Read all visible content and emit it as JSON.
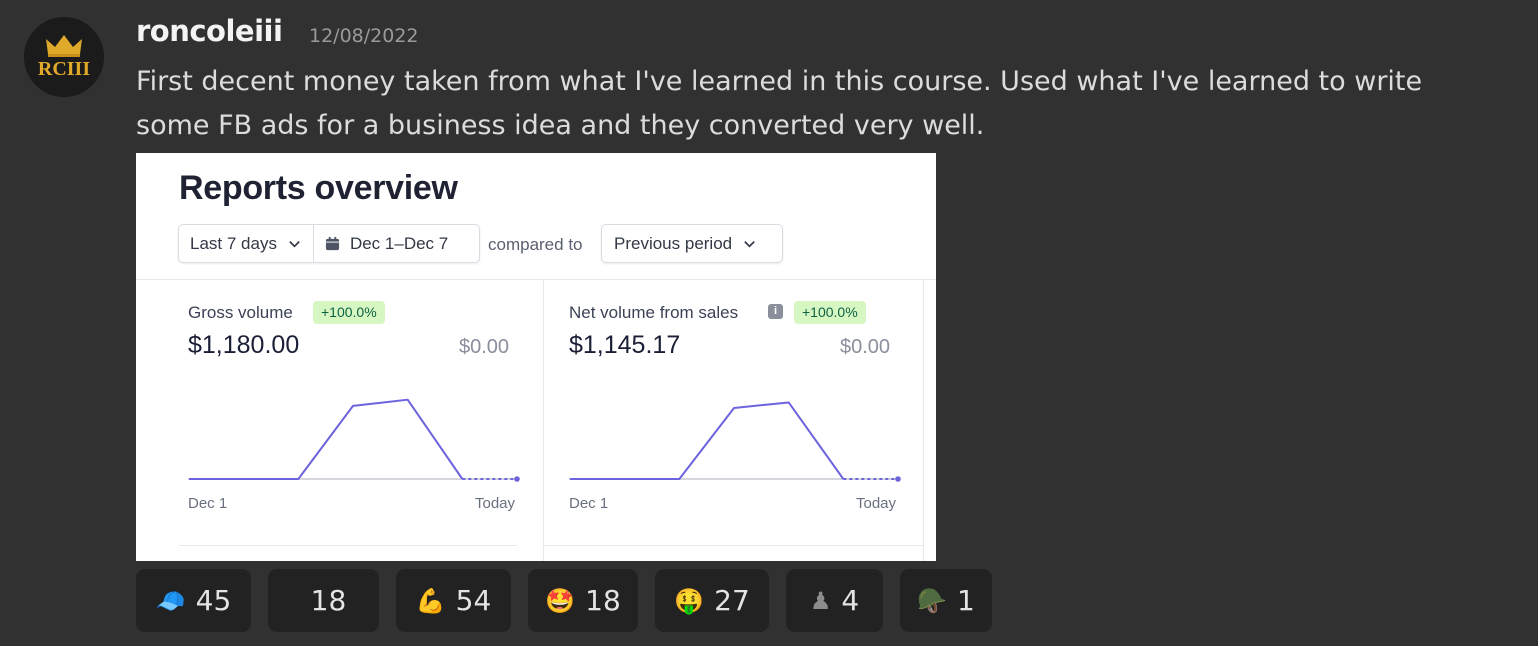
{
  "message": {
    "avatar_text": "RCIII",
    "username": "roncoleiii",
    "timestamp": "12/08/2022",
    "text": "First decent money taken from what I've learned in this course. Used what I've learned to write some FB ads for a business idea and they converted very well."
  },
  "report": {
    "title": "Reports overview",
    "range_label": "Last 7 days",
    "date_range": "Dec 1–Dec 7",
    "compared_to": "compared to",
    "comparison": "Previous period",
    "line_color": "#6c63dd",
    "badge_color": "#d7f7c2",
    "cards": [
      {
        "label": "Gross volume",
        "badge": "+100.0%",
        "value": "$1,180.00",
        "previous": "$0.00",
        "x_start": "Dec 1",
        "x_end": "Today",
        "has_info_icon": false,
        "series": [
          0,
          0,
          0,
          530,
          575,
          0,
          0
        ]
      },
      {
        "label": "Net volume from sales",
        "badge": "+100.0%",
        "value": "$1,145.17",
        "previous": "$0.00",
        "x_start": "Dec 1",
        "x_end": "Today",
        "has_info_icon": true,
        "series": [
          0,
          0,
          0,
          515,
          555,
          0,
          0
        ]
      }
    ]
  },
  "reactions": [
    {
      "emoji": "🧢",
      "count": "45",
      "dim": false
    },
    {
      "emoji": "",
      "count": "18",
      "dim": false
    },
    {
      "emoji": "💪",
      "count": "54",
      "dim": false
    },
    {
      "emoji": "🤩",
      "count": "18",
      "dim": false
    },
    {
      "emoji": "🤑",
      "count": "27",
      "dim": false
    },
    {
      "emoji": "♟",
      "count": "4",
      "dim": true
    },
    {
      "emoji": "🪖",
      "count": "1",
      "dim": false
    }
  ]
}
